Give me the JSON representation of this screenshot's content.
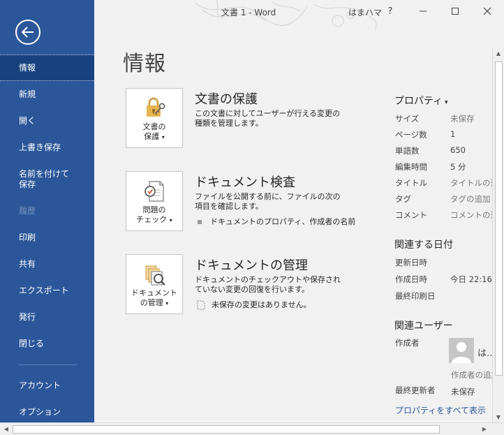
{
  "window": {
    "title": "文書 1 - Word",
    "user": "はまハマ",
    "help": "?",
    "minimize": "—",
    "maximize": "☐",
    "close": "✕"
  },
  "sidebar": {
    "items": [
      {
        "label": "情報"
      },
      {
        "label": "新規"
      },
      {
        "label": "開く"
      },
      {
        "label": "上書き保存"
      },
      {
        "label": "名前を付けて\n保存"
      },
      {
        "label": "履歴"
      },
      {
        "label": "印刷"
      },
      {
        "label": "共有"
      },
      {
        "label": "エクスポート"
      },
      {
        "label": "発行"
      },
      {
        "label": "閉じる"
      },
      {
        "label": "アカウント"
      },
      {
        "label": "オプション"
      }
    ]
  },
  "main": {
    "title": "情報",
    "sections": [
      {
        "tile_label_1": "文書の",
        "tile_label_2": "保護",
        "heading": "文書の保護",
        "desc": "この文書に対してユーザーが行える変更の種類を管理します。"
      },
      {
        "tile_label_1": "問題の",
        "tile_label_2": "チェック",
        "heading": "ドキュメント検査",
        "desc": "ファイルを公開する前に、ファイルの次の項目を確認します。",
        "bullet": "ドキュメントのプロパティ、作成者の名前"
      },
      {
        "tile_label_1": "ドキュメント",
        "tile_label_2": "の管理",
        "heading": "ドキュメントの管理",
        "desc": "ドキュメントのチェックアウトや保存されていない変更の回復を行います。",
        "bullet": "未保存の変更はありません。"
      }
    ]
  },
  "properties": {
    "heading": "プロパティ",
    "rows": [
      {
        "key": "サイズ",
        "value": "未保存"
      },
      {
        "key": "ページ数",
        "value": "1"
      },
      {
        "key": "単語数",
        "value": "650"
      },
      {
        "key": "編集時間",
        "value": "5 分"
      },
      {
        "key": "タイトル",
        "value": "タイトルの追加"
      },
      {
        "key": "タグ",
        "value": "タグの追加"
      },
      {
        "key": "コメント",
        "value": "コメントの追加"
      }
    ],
    "dates_heading": "関連する日付",
    "dates": [
      {
        "key": "更新日時",
        "value": ""
      },
      {
        "key": "作成日時",
        "value": "今日 22:16"
      },
      {
        "key": "最終印刷日",
        "value": ""
      }
    ],
    "people_heading": "関連ユーザー",
    "author_key": "作成者",
    "author_name": "は…",
    "add_author": "作成者の追加",
    "last_modified_key": "最終更新者",
    "last_modified_value": "未保存",
    "show_all": "プロパティをすべて表示"
  },
  "colors": {
    "sidebar": "#2b579a",
    "sidebar_active": "#18427f",
    "link": "#2b579a"
  }
}
